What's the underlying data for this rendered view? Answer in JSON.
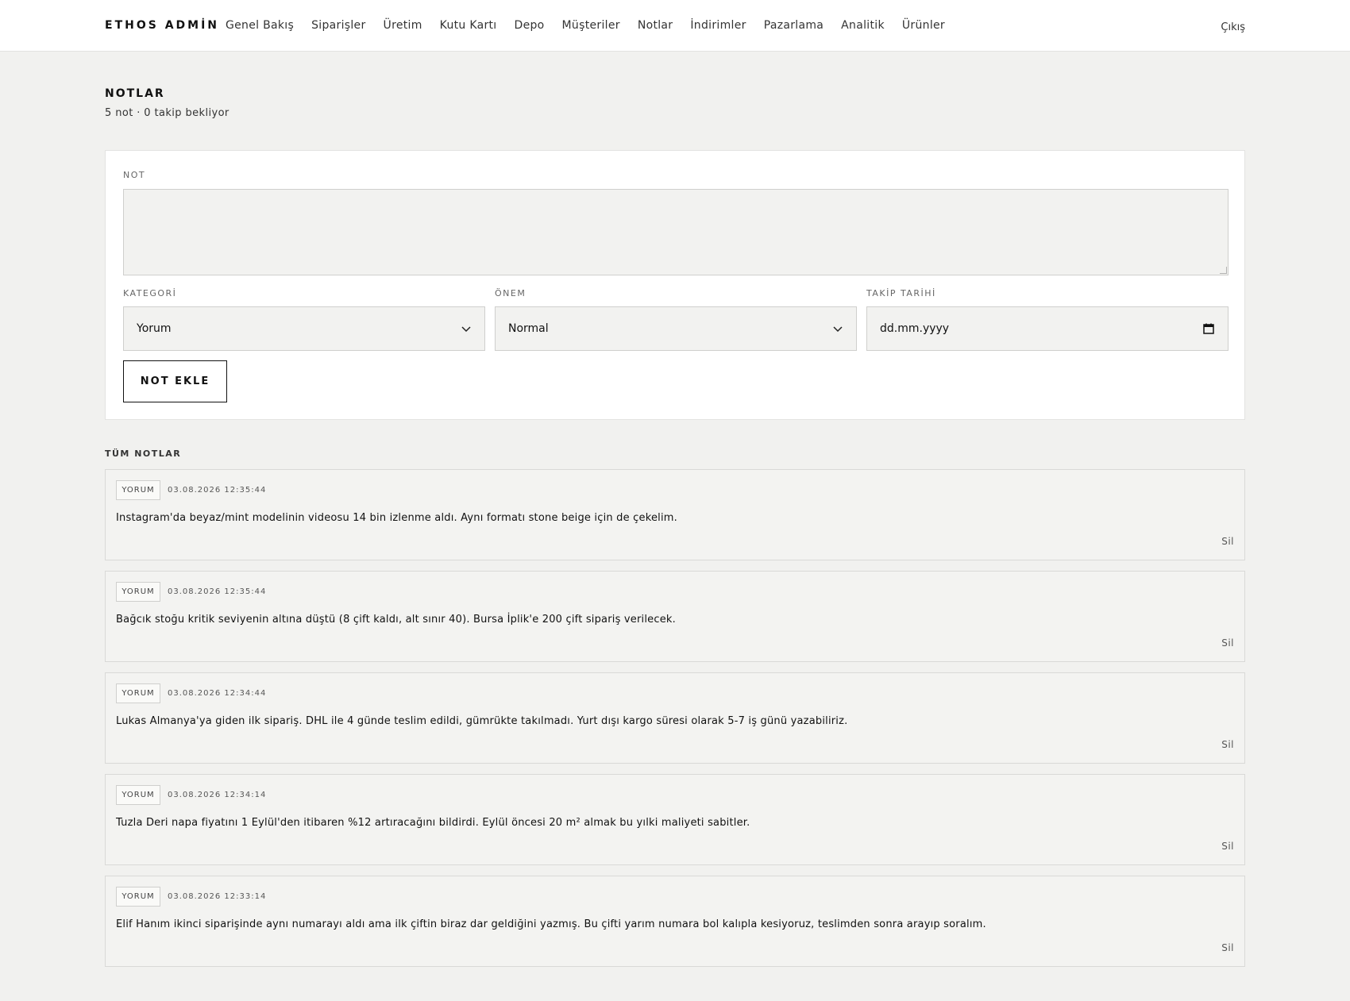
{
  "header": {
    "brand": "ETHOS ADMİN",
    "nav": [
      "Genel Bakış",
      "Siparişler",
      "Üretim",
      "Kutu Kartı",
      "Depo",
      "Müşteriler",
      "Notlar",
      "İndirimler",
      "Pazarlama",
      "Analitik",
      "Ürünler"
    ],
    "logout": "Çıkış"
  },
  "page": {
    "title": "NOTLAR",
    "subtitle": "5 not · 0 takip bekliyor"
  },
  "form": {
    "note_label": "NOT",
    "note_value": "",
    "category_label": "KATEGORİ",
    "category_value": "Yorum",
    "priority_label": "ÖNEM",
    "priority_value": "Normal",
    "followup_label": "TAKİP TARİHİ",
    "followup_placeholder": "dd.mm.yyyy",
    "submit": "NOT EKLE"
  },
  "list": {
    "title": "TÜM NOTLAR",
    "delete_label": "Sil",
    "notes": [
      {
        "category": "YORUM",
        "timestamp": "03.08.2026 12:35:44",
        "text": "Instagram'da beyaz/mint modelinin videosu 14 bin izlenme aldı. Aynı formatı stone beige için de çekelim."
      },
      {
        "category": "YORUM",
        "timestamp": "03.08.2026 12:35:44",
        "text": "Bağcık stoğu kritik seviyenin altına düştü (8 çift kaldı, alt sınır 40). Bursa İplik'e 200 çift sipariş verilecek."
      },
      {
        "category": "YORUM",
        "timestamp": "03.08.2026 12:34:44",
        "text": "Lukas Almanya'ya giden ilk sipariş. DHL ile 4 günde teslim edildi, gümrükte takılmadı. Yurt dışı kargo süresi olarak 5-7 iş günü yazabiliriz."
      },
      {
        "category": "YORUM",
        "timestamp": "03.08.2026 12:34:14",
        "text": "Tuzla Deri napa fiyatını 1 Eylül'den itibaren %12 artıracağını bildirdi. Eylül öncesi 20 m² almak bu yılki maliyeti sabitler."
      },
      {
        "category": "YORUM",
        "timestamp": "03.08.2026 12:33:14",
        "text": "Elif Hanım ikinci siparişinde aynı numarayı aldı ama ilk çiftin biraz dar geldiğini yazmış. Bu çifti yarım numara bol kalıpla kesiyoruz, teslimden sonra arayıp soralım."
      }
    ]
  },
  "icons": {
    "select": "chevron-down-icon",
    "date": "calendar-icon"
  }
}
